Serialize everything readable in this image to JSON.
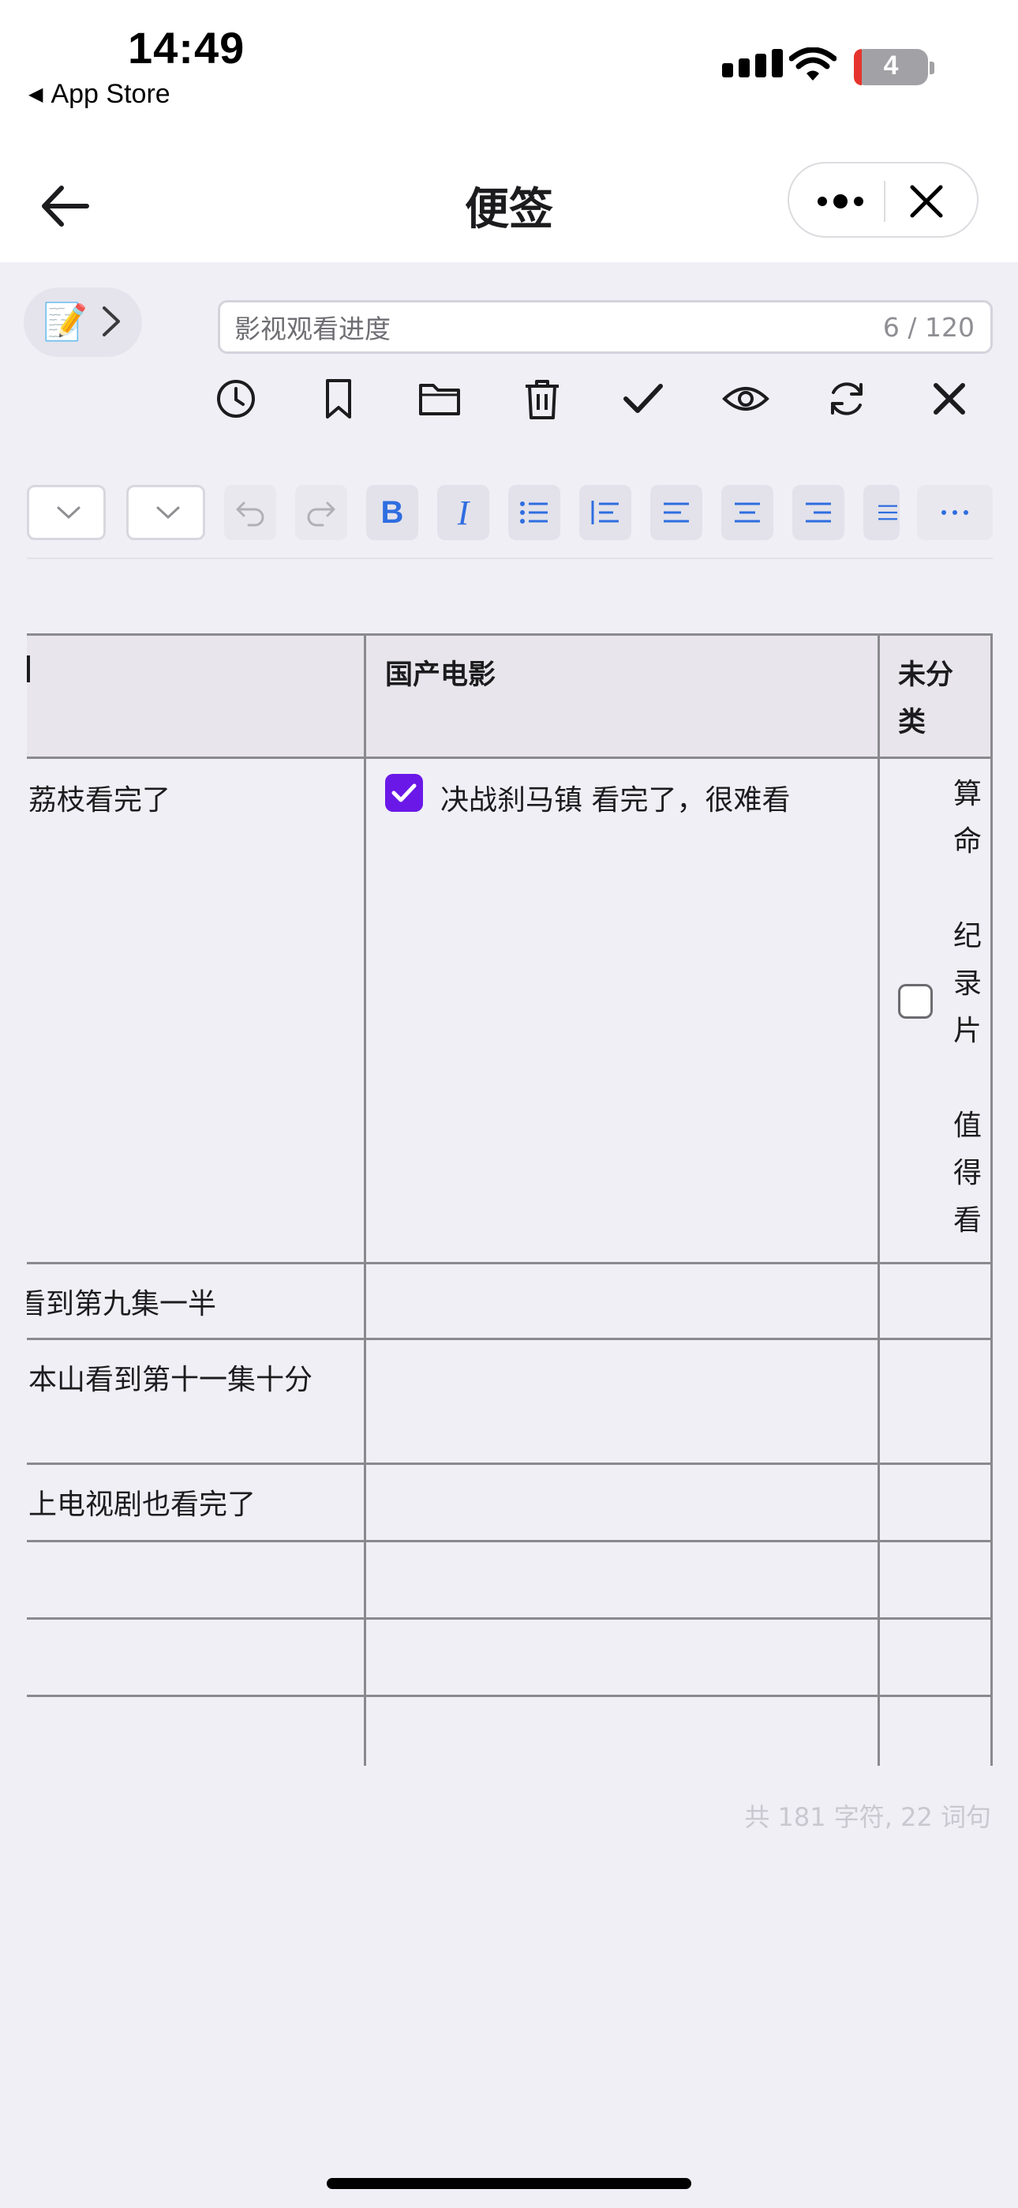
{
  "status_bar": {
    "time": "14:49",
    "back_label": "App Store",
    "battery": "4"
  },
  "nav": {
    "title": "便签",
    "back_icon": "arrow-left-icon",
    "more_icon": "more-dots-icon",
    "close_icon": "close-icon"
  },
  "note": {
    "emoji": "📝",
    "title_value": "影视观看进度",
    "title_counter": "6 / 120"
  },
  "action_toolbar": [
    "history-icon",
    "bookmark-icon",
    "folder-icon",
    "trash-icon",
    "check-icon",
    "eye-icon",
    "refresh-icon",
    "close-icon"
  ],
  "format_toolbar": {
    "bold_label": "B",
    "italic_label": "I"
  },
  "table": {
    "headers": [
      "",
      "国产电影",
      "未分类"
    ],
    "header_col3_line1": "未分",
    "header_col3_line2": "类",
    "rows": [
      {
        "col1": "荔枝看完了",
        "col2": "决战刹马镇 看完了，很难看",
        "col2_checked": true,
        "col3_checked": false
      },
      {
        "col1": "看到第九集一半",
        "col2": "",
        "col3": ""
      },
      {
        "col1": "本山看到第十一集十分",
        "col2": "",
        "col3": ""
      },
      {
        "col1": "上电视剧也看完了",
        "col2": "",
        "col3": ""
      },
      {
        "col1": "",
        "col2": "",
        "col3": ""
      },
      {
        "col1": "",
        "col2": "",
        "col3": ""
      },
      {
        "col1": "",
        "col2": "",
        "col3": ""
      }
    ],
    "col3_vertical_lines": [
      "算",
      "命",
      "",
      "纪",
      "录",
      "片",
      "",
      "值",
      "得",
      "看"
    ]
  },
  "footer": {
    "word_count": "共 181 字符, 22 词句"
  }
}
